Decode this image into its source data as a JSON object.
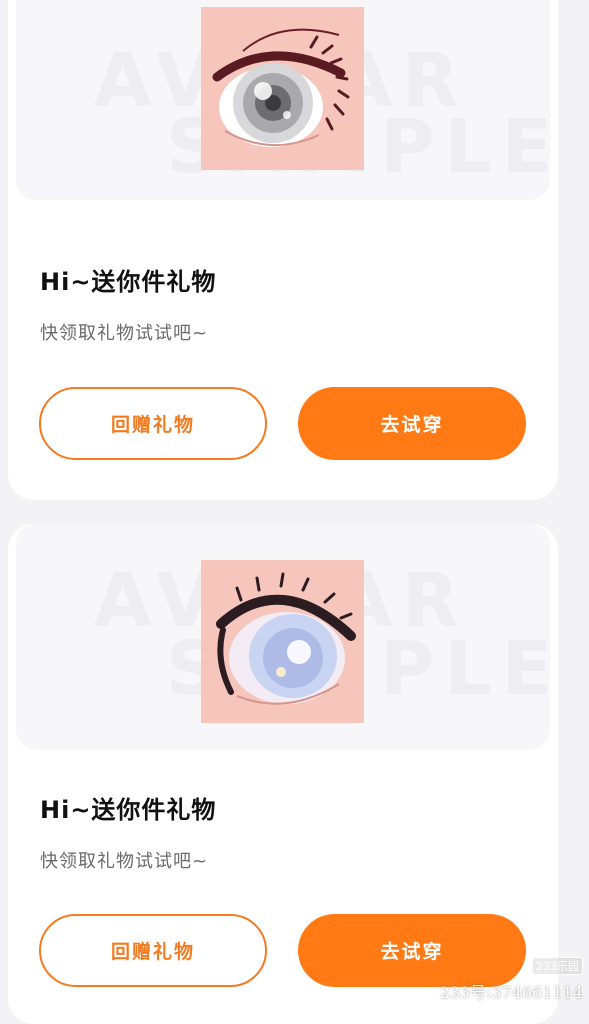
{
  "colors": {
    "page_background": "#f3f3f6",
    "card_background": "#ffffff",
    "accent": "#ff7a14",
    "outline_accent": "#f47b20",
    "title_text": "#111111",
    "subtitle_text": "#6b6b6b",
    "thumbnail_background": "#f6c6bc"
  },
  "gift_cards": [
    {
      "watermark_line1": "AVATAR",
      "watermark_line2": "SAMPLE",
      "thumbnail_icon": "anime-eye-grey-icon",
      "title": "Hi~送你件礼物",
      "subtitle": "快领取礼物试试吧~",
      "return_gift_label": "回赠礼物",
      "try_on_label": "去试穿"
    },
    {
      "watermark_line1": "AVATAR",
      "watermark_line2": "SAMPLE",
      "thumbnail_icon": "anime-eye-blue-icon",
      "title": "Hi~送你件礼物",
      "subtitle": "快领取礼物试试吧~",
      "return_gift_label": "回赠礼物",
      "try_on_label": "去试穿"
    }
  ],
  "site_watermark": {
    "logo": "233乐园",
    "user_id": "233号:374661114"
  }
}
